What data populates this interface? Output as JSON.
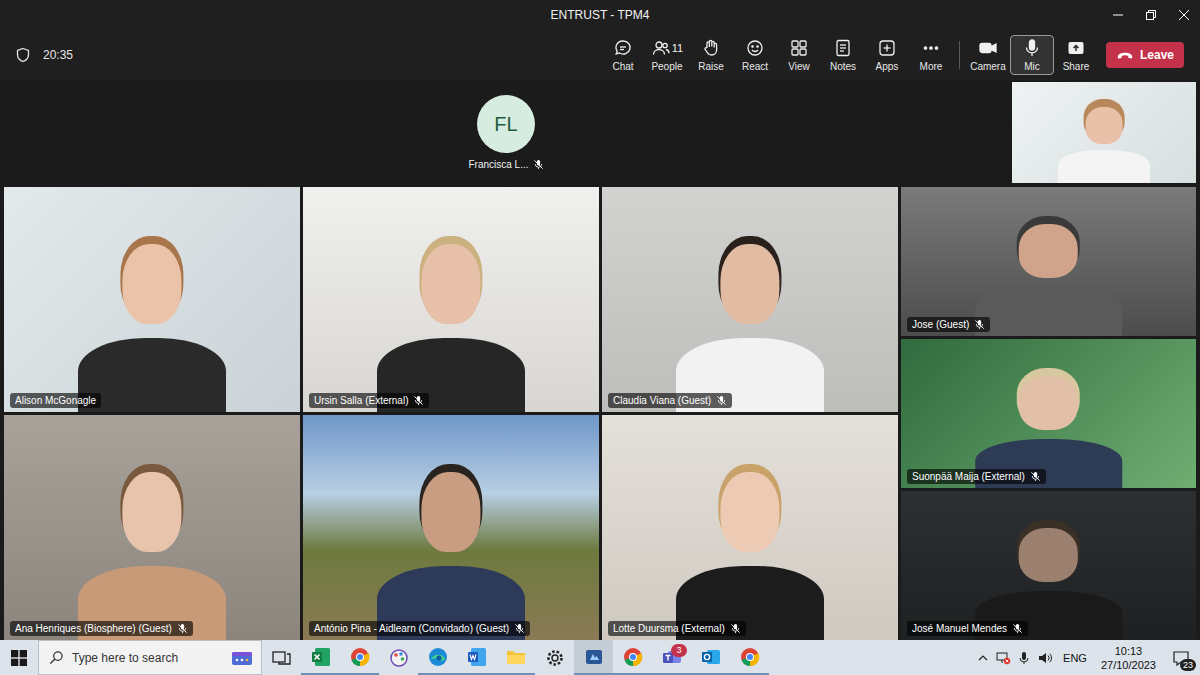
{
  "window": {
    "title": "ENTRUST - TPM4"
  },
  "toolbar": {
    "time": "20:35",
    "buttons": [
      {
        "kind": "chat",
        "label": "Chat",
        "selected": false
      },
      {
        "kind": "people",
        "label": "People",
        "count": "11",
        "selected": false
      },
      {
        "kind": "raise",
        "label": "Raise",
        "selected": false
      },
      {
        "kind": "react",
        "label": "React",
        "selected": false
      },
      {
        "kind": "view",
        "label": "View",
        "selected": false
      },
      {
        "kind": "notes",
        "label": "Notes",
        "selected": false
      },
      {
        "kind": "apps",
        "label": "Apps",
        "selected": false
      },
      {
        "kind": "more",
        "label": "More",
        "selected": false
      }
    ],
    "media_buttons": [
      {
        "kind": "camera",
        "label": "Camera",
        "selected": false
      },
      {
        "kind": "mic",
        "label": "Mic",
        "selected": true
      },
      {
        "kind": "share",
        "label": "Share",
        "selected": false
      }
    ],
    "leave": {
      "label": "Leave"
    }
  },
  "stage": {
    "avatar": {
      "initials": "FL",
      "name": "Francisca L...",
      "muted": true
    },
    "grid_tiles": [
      {
        "name": "Alison McGonagle",
        "muted": false
      },
      {
        "name": "Ursin Salla (External)",
        "muted": true
      },
      {
        "name": "Claudia Viana (Guest)",
        "muted": true
      },
      {
        "name": "Ana Henriques (Biosphere) (Guest)",
        "muted": true
      },
      {
        "name": "António Pina - Aidlearn (Convidado) (Guest)",
        "muted": true
      },
      {
        "name": "Lotte Duursma (External)",
        "muted": true
      }
    ],
    "side_tiles": [
      {
        "name": "Jose (Guest)",
        "muted": true
      },
      {
        "name": "Suonpää Maija (External)",
        "muted": true
      },
      {
        "name": "José Manuel Mendes",
        "muted": true
      }
    ]
  },
  "taskbar": {
    "search_placeholder": "Type here to search",
    "apps": [
      {
        "kind": "taskview",
        "running": false,
        "selected": false,
        "badge": ""
      },
      {
        "kind": "excel",
        "running": true,
        "selected": false,
        "badge": ""
      },
      {
        "kind": "chrome",
        "running": true,
        "selected": false,
        "badge": ""
      },
      {
        "kind": "paint",
        "running": false,
        "selected": false,
        "badge": ""
      },
      {
        "kind": "edge",
        "running": true,
        "selected": false,
        "badge": ""
      },
      {
        "kind": "word",
        "running": true,
        "selected": false,
        "badge": ""
      },
      {
        "kind": "explorer",
        "running": true,
        "selected": false,
        "badge": ""
      },
      {
        "kind": "settings",
        "running": false,
        "selected": false,
        "badge": ""
      },
      {
        "kind": "snip",
        "running": true,
        "selected": true,
        "badge": ""
      },
      {
        "kind": "chrome",
        "running": true,
        "selected": false,
        "badge": ""
      },
      {
        "kind": "teams",
        "running": true,
        "selected": false,
        "badge": "3"
      },
      {
        "kind": "outlook",
        "running": true,
        "selected": false,
        "badge": ""
      },
      {
        "kind": "chrome",
        "running": true,
        "selected": false,
        "badge": ""
      }
    ],
    "tray": {
      "language": "ENG",
      "time": "10:13",
      "date": "27/10/2023",
      "notifications": "23"
    }
  }
}
